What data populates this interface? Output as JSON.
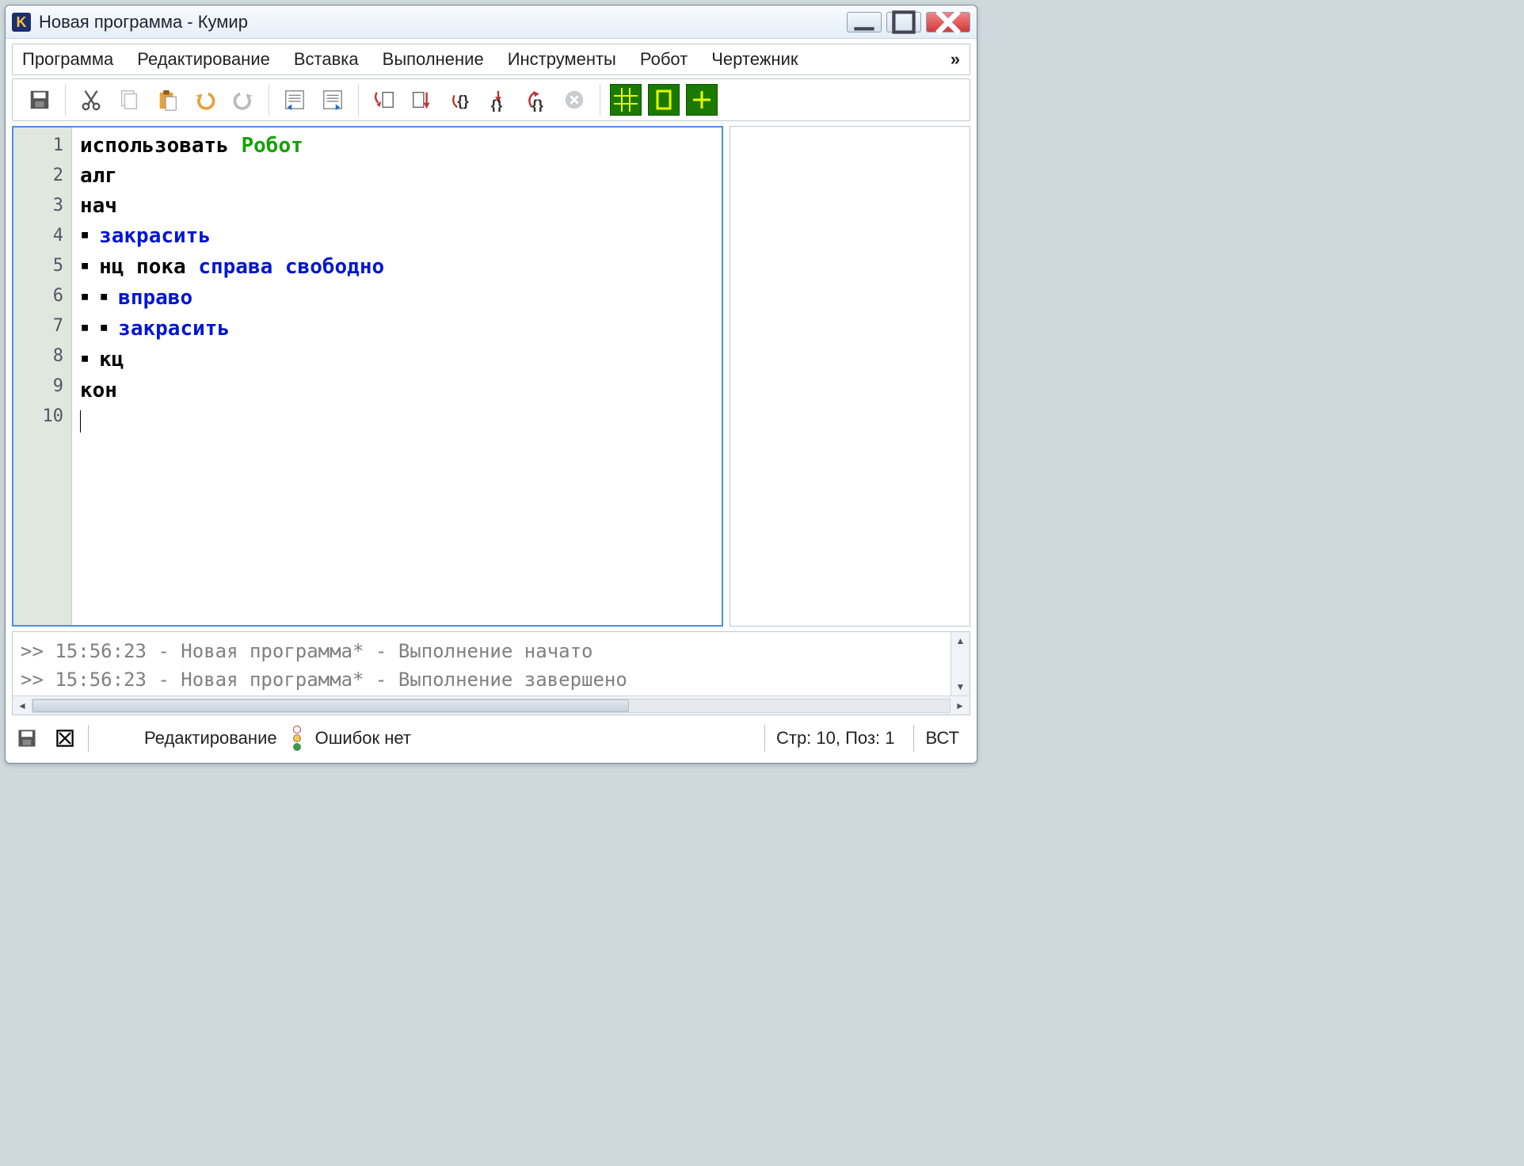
{
  "window": {
    "title": "Новая программа - Кумир",
    "icon_letter": "K"
  },
  "menu": {
    "items": [
      "Программа",
      "Редактирование",
      "Вставка",
      "Выполнение",
      "Инструменты",
      "Робот",
      "Чертежник"
    ],
    "overflow": "»"
  },
  "toolbar": {
    "icons": {
      "save": "save-icon",
      "cut": "cut-icon",
      "copy": "copy-icon",
      "paste": "paste-icon",
      "undo": "undo-icon",
      "redo": "redo-icon",
      "indent_left": "indent-left-icon",
      "indent_right": "indent-right-icon",
      "step_into": "step-into-icon",
      "step_over": "step-over-icon",
      "run": "run-icon",
      "run_to": "run-to-icon",
      "run_fast": "run-fast-icon",
      "stop": "stop-icon",
      "robot_grid": "robot-grid-icon",
      "robot_field": "robot-field-icon",
      "robot_pen": "robot-pen-icon"
    }
  },
  "editor": {
    "line_numbers": [
      "1",
      "2",
      "3",
      "4",
      "5",
      "6",
      "7",
      "8",
      "9",
      "10"
    ],
    "lines": [
      {
        "tokens": [
          {
            "t": "использовать ",
            "c": "black"
          },
          {
            "t": "Робот",
            "c": "green"
          }
        ]
      },
      {
        "tokens": [
          {
            "t": "алг",
            "c": "black"
          }
        ]
      },
      {
        "tokens": [
          {
            "t": "нач",
            "c": "black"
          }
        ]
      },
      {
        "tokens": [
          {
            "t": "· ",
            "c": "dot"
          },
          {
            "t": "закрасить",
            "c": "blue"
          }
        ]
      },
      {
        "tokens": [
          {
            "t": "· ",
            "c": "dot"
          },
          {
            "t": "нц пока ",
            "c": "black"
          },
          {
            "t": "справа свободно",
            "c": "blue"
          }
        ]
      },
      {
        "tokens": [
          {
            "t": "· · ",
            "c": "dot"
          },
          {
            "t": "вправо",
            "c": "blue"
          }
        ]
      },
      {
        "tokens": [
          {
            "t": "· · ",
            "c": "dot"
          },
          {
            "t": "закрасить",
            "c": "blue"
          }
        ]
      },
      {
        "tokens": [
          {
            "t": "· ",
            "c": "dot"
          },
          {
            "t": "кц",
            "c": "black"
          }
        ]
      },
      {
        "tokens": [
          {
            "t": "кон",
            "c": "black"
          }
        ]
      },
      {
        "tokens": []
      }
    ]
  },
  "console": {
    "lines": [
      ">> 15:56:23 - Новая программа* - Выполнение начато",
      ">> 15:56:23 - Новая программа* - Выполнение завершено"
    ]
  },
  "status": {
    "mode": "Редактирование",
    "errors": "Ошибок нет",
    "position": "Стр: 10, Поз: 1",
    "insert": "ВСТ"
  }
}
